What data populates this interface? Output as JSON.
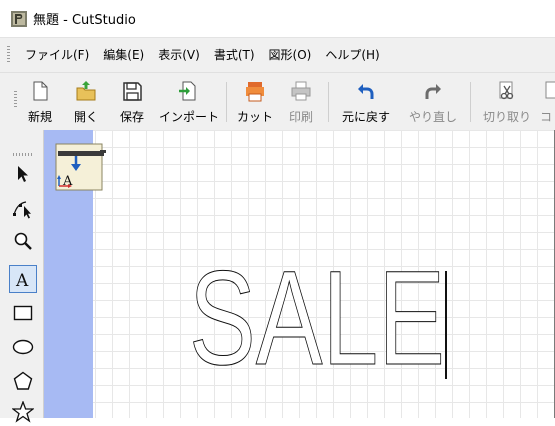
{
  "window": {
    "title": "無題 - CutStudio",
    "app_icon": "cutstudio-app-icon"
  },
  "menu": {
    "items": [
      "ファイル(F)",
      "編集(E)",
      "表示(V)",
      "書式(T)",
      "図形(O)",
      "ヘルプ(H)"
    ]
  },
  "toolbar": {
    "buttons": [
      {
        "label": "新規",
        "icon": "new-document-icon",
        "enabled": true
      },
      {
        "label": "開く",
        "icon": "open-folder-icon",
        "enabled": true
      },
      {
        "label": "保存",
        "icon": "save-disk-icon",
        "enabled": true
      },
      {
        "label": "インポート",
        "icon": "import-icon",
        "enabled": true
      },
      {
        "label": "カット",
        "icon": "cut-to-plotter-icon",
        "enabled": true
      },
      {
        "label": "印刷",
        "icon": "printer-icon",
        "enabled": false
      },
      {
        "label": "元に戻す",
        "icon": "undo-icon",
        "enabled": true
      },
      {
        "label": "やり直し",
        "icon": "redo-icon",
        "enabled": false
      },
      {
        "label": "切り取り",
        "icon": "scissors-icon",
        "enabled": false
      },
      {
        "label": "コ",
        "icon": "copy-icon",
        "enabled": false
      }
    ]
  },
  "tools": [
    "select-arrow-icon",
    "node-edit-icon",
    "zoom-icon",
    "text-tool-icon",
    "rectangle-icon",
    "ellipse-icon",
    "polygon-icon",
    "star-icon"
  ],
  "active_tool": "text-tool-icon",
  "canvas": {
    "text_object": "SALE",
    "colors": {
      "media_strip": "#a7baf3",
      "grid": "#e7e7e7",
      "selection": "#4a80c8",
      "undo_blue": "#1f5fbf"
    }
  }
}
